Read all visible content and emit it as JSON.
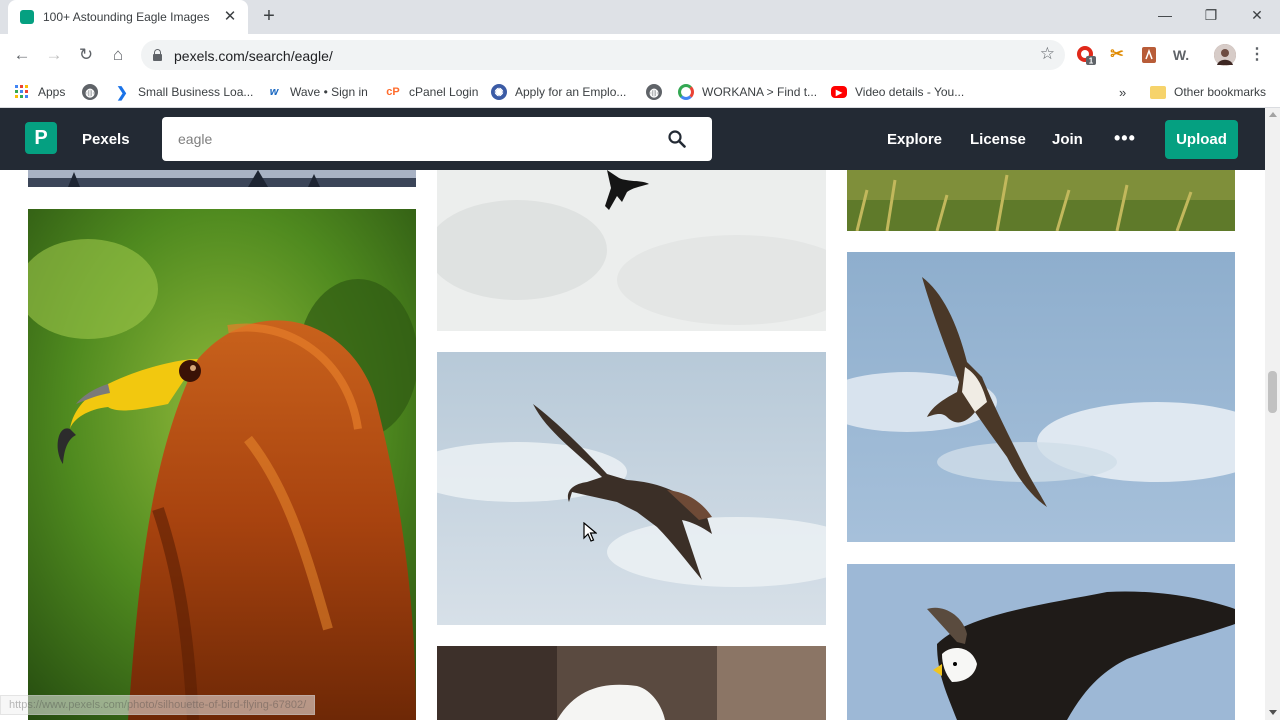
{
  "browser": {
    "tab_title": "100+ Astounding Eagle Images",
    "url": "pexels.com/search/eagle/",
    "bookmarks": [
      {
        "label": "Apps",
        "icon": "apps-grid-icon"
      },
      {
        "label": "",
        "icon": "globe-icon"
      },
      {
        "label": "Small Business Loa...",
        "icon": "chevron-arrow-icon"
      },
      {
        "label": "Wave • Sign in",
        "icon": "wave-logo-icon"
      },
      {
        "label": "cPanel Login",
        "icon": "cpanel-icon"
      },
      {
        "label": "Apply for an Emplo...",
        "icon": "seal-icon"
      },
      {
        "label": "",
        "icon": "globe-icon"
      },
      {
        "label": "WORKANA > Find t...",
        "icon": "workana-icon"
      },
      {
        "label": "Video details - You...",
        "icon": "youtube-icon"
      }
    ],
    "overflow_label": "»",
    "other_bookmarks": "Other bookmarks",
    "extensions": [
      "opera-badge-icon",
      "scissors-icon",
      "pdf-icon",
      "w-extension-icon",
      "profile-avatar"
    ],
    "extension_badge": "1",
    "ext_w_label": "W.",
    "status_url": "https://www.pexels.com/photo/silhouette-of-bird-flying-67802/"
  },
  "pexels": {
    "brand": "Pexels",
    "logo_letter": "P",
    "search_value": "eagle",
    "nav": [
      "Explore",
      "License",
      "Join"
    ],
    "more_label": "•••",
    "upload_label": "Upload"
  },
  "gallery": {
    "photos": [
      {
        "name": "photo-snowy-trees-partial",
        "subject": "snowy forest"
      },
      {
        "name": "photo-golden-eagle-portrait",
        "subject": "golden eagle portrait"
      },
      {
        "name": "photo-bird-silhouette-sky",
        "subject": "bird silhouette in cloudy sky"
      },
      {
        "name": "photo-eagle-flying-clouds",
        "subject": "eagle flying in clouds"
      },
      {
        "name": "photo-bald-eagle-partial",
        "subject": "bald eagle head"
      },
      {
        "name": "photo-grass-partial",
        "subject": "grass field"
      },
      {
        "name": "photo-osprey-flying",
        "subject": "osprey in flight"
      },
      {
        "name": "photo-bald-eagle-wings",
        "subject": "bald eagle spreading wings"
      }
    ]
  },
  "colors": {
    "pexels_green": "#05a081",
    "header_bg": "#232a34"
  }
}
